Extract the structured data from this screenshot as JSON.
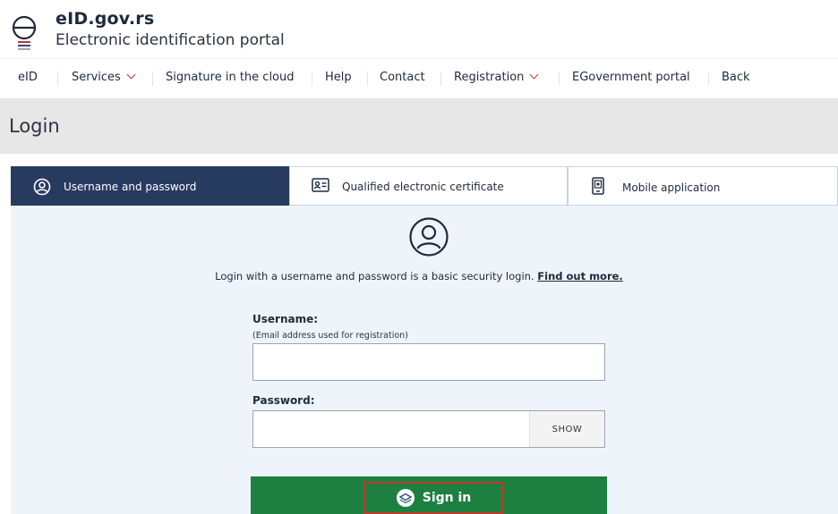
{
  "header": {
    "site_name": "eID.gov.rs",
    "subtitle": "Electronic identification portal"
  },
  "nav": {
    "items": [
      {
        "label": "eID",
        "has_dropdown": false
      },
      {
        "label": "Services",
        "has_dropdown": true
      },
      {
        "label": "Signature in the cloud",
        "has_dropdown": false
      },
      {
        "label": "Help",
        "has_dropdown": false
      },
      {
        "label": "Contact",
        "has_dropdown": false
      },
      {
        "label": "Registration",
        "has_dropdown": true
      },
      {
        "label": "EGovernment portal",
        "has_dropdown": false
      },
      {
        "label": "Back",
        "has_dropdown": false
      }
    ]
  },
  "page": {
    "title": "Login"
  },
  "tabs": [
    {
      "label": "Username and password",
      "icon": "user-circle-icon",
      "active": true
    },
    {
      "label": "Qualified electronic certificate",
      "icon": "id-card-icon",
      "active": false
    },
    {
      "label": "Mobile application",
      "icon": "mobile-phone-icon",
      "active": false
    }
  ],
  "login": {
    "intro_text": "Login with a username and password is a basic security login.",
    "intro_link": "Find out more.",
    "username_label": "Username:",
    "username_hint": "(Email address used for registration)",
    "username_value": "",
    "password_label": "Password:",
    "password_value": "",
    "show_label": "SHOW",
    "signin_label": "Sign in"
  },
  "colors": {
    "tab_active": "#273a5f",
    "panel_bg": "#eef4fa",
    "signin_bg": "#1e8040",
    "highlight_border": "#c0392b",
    "title_bar": "#e7e7e7"
  }
}
